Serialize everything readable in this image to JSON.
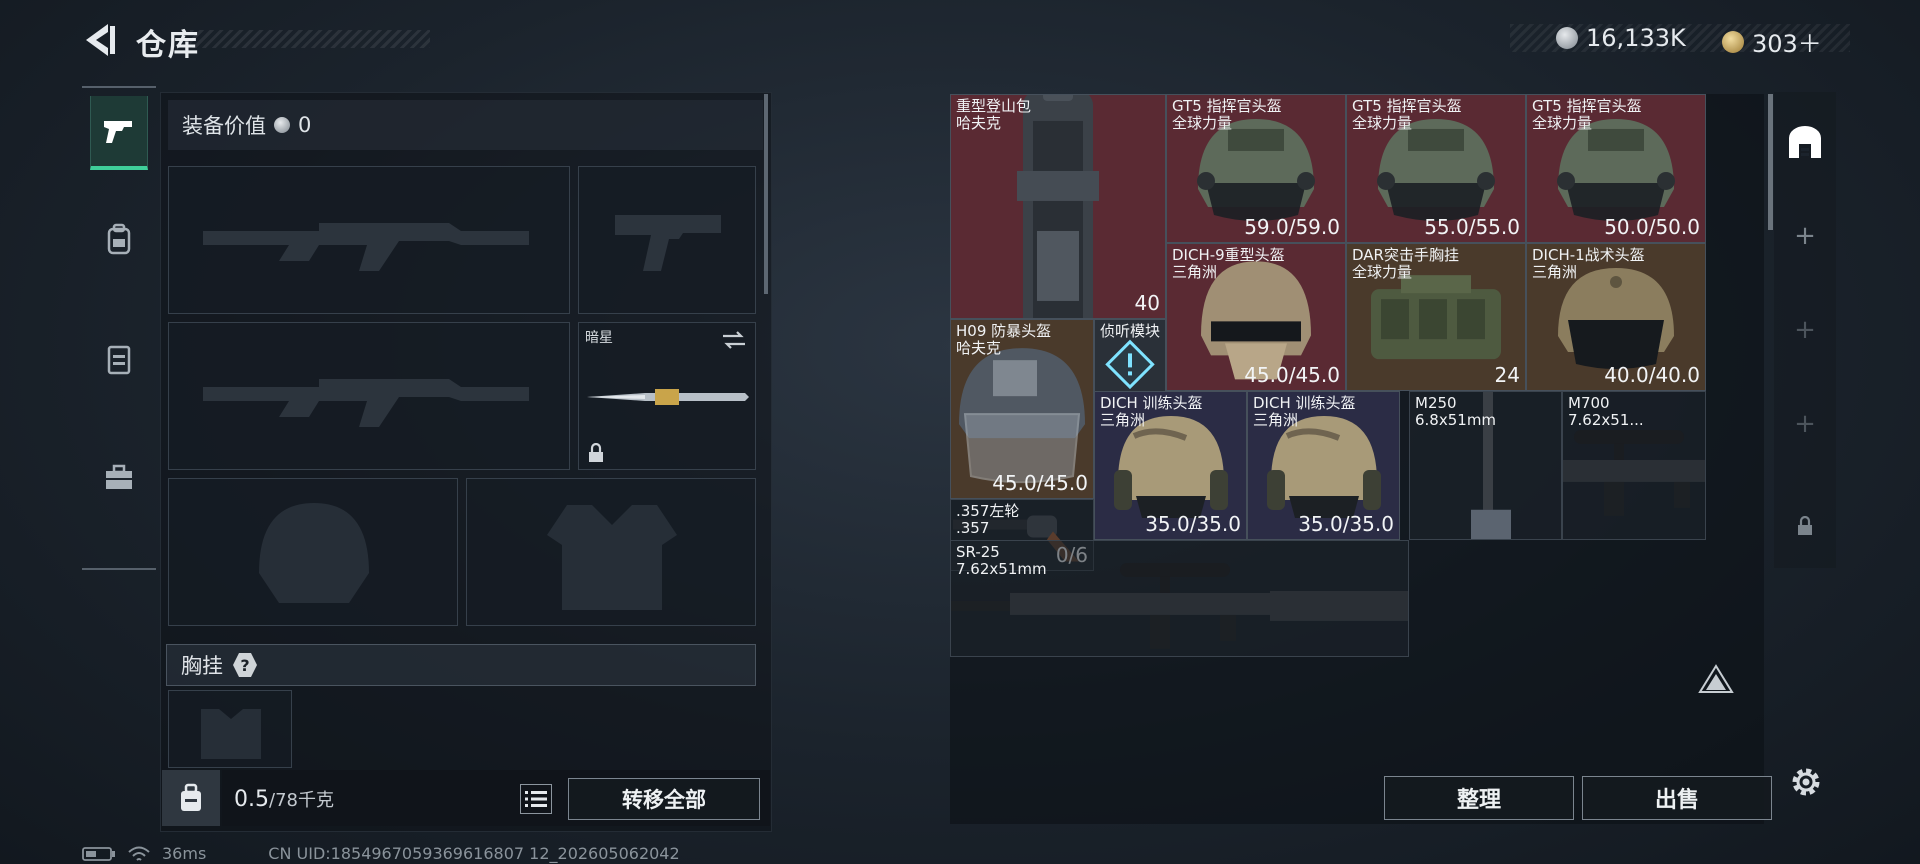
{
  "header": {
    "title": "仓库",
    "currency1_value": "16,133K",
    "currency2_value": "303＋"
  },
  "tabs": [
    {
      "name": "weapons",
      "icon": "gun-icon",
      "active": true
    },
    {
      "name": "backpack",
      "icon": "backpack-icon",
      "active": false
    },
    {
      "name": "vest",
      "icon": "vest-icon",
      "active": false
    },
    {
      "name": "toolbox",
      "icon": "toolbox-icon",
      "active": false
    }
  ],
  "loadout": {
    "equip_value_label": "装备价值",
    "equip_value": "0",
    "melee_name": "暗星",
    "chest_rig_label": "胸挂",
    "help": "?"
  },
  "footer": {
    "weight_current": "0.5",
    "weight_max": "/78千克",
    "transfer_all": "转移全部",
    "ping": "36ms",
    "uid": "CN UID:1854967059369616807 12_202605062042"
  },
  "stash": {
    "items": [
      {
        "name": "重型登山包",
        "sub": "哈夫克",
        "value": "40",
        "color": "red",
        "kind": "backpack"
      },
      {
        "name": "GT5 指挥官头盔",
        "sub": "全球力量",
        "value": "59.0/59.0",
        "color": "red",
        "kind": "helmet-gt5"
      },
      {
        "name": "GT5 指挥官头盔",
        "sub": "全球力量",
        "value": "55.0/55.0",
        "color": "red",
        "kind": "helmet-gt5"
      },
      {
        "name": "GT5 指挥官头盔",
        "sub": "全球力量",
        "value": "50.0/50.0",
        "color": "red",
        "kind": "helmet-gt5"
      },
      {
        "name": "DICH-9重型头盔",
        "sub": "三角洲",
        "value": "45.0/45.0",
        "color": "red",
        "kind": "helmet-dich9"
      },
      {
        "name": "DAR突击手胸挂",
        "sub": "全球力量",
        "value": "24",
        "color": "brown",
        "kind": "chest-rig"
      },
      {
        "name": "DICH-1战术头盔",
        "sub": "三角洲",
        "value": "40.0/40.0",
        "color": "brown",
        "kind": "helmet-dich1"
      },
      {
        "name": "H09 防暴头盔",
        "sub": "哈夫克",
        "value": "45.0/45.0",
        "color": "brown",
        "kind": "helmet-riot"
      },
      {
        "name": "侦听模块",
        "sub": "",
        "value": "",
        "color": "gray",
        "kind": "module"
      },
      {
        "name": "DICH 训练头盔",
        "sub": "三角洲",
        "value": "35.0/35.0",
        "color": "purple",
        "kind": "helmet-train"
      },
      {
        "name": "DICH 训练头盔",
        "sub": "三角洲",
        "value": "35.0/35.0",
        "color": "purple",
        "kind": "helmet-train"
      },
      {
        "name": "M250",
        "sub": "6.8x51mm",
        "value": "",
        "color": "empty",
        "kind": "ammo"
      },
      {
        "name": "M700",
        "sub": "7.62x51...",
        "value": "",
        "color": "empty",
        "kind": "rifle"
      },
      {
        "name": ".357左轮",
        "sub": ".357",
        "value": "0/6",
        "color": "empty",
        "kind": "revolver"
      },
      {
        "name": "SR-25",
        "sub": "7.62x51mm",
        "value": "",
        "color": "empty",
        "kind": "rifle"
      }
    ],
    "sort": "整理",
    "sell": "出售"
  },
  "colors": {
    "accent": "#3fcf9a",
    "rarity_red": "#5a2a33",
    "rarity_brown": "#4a3a2b",
    "rarity_purple": "#2b2c45"
  }
}
